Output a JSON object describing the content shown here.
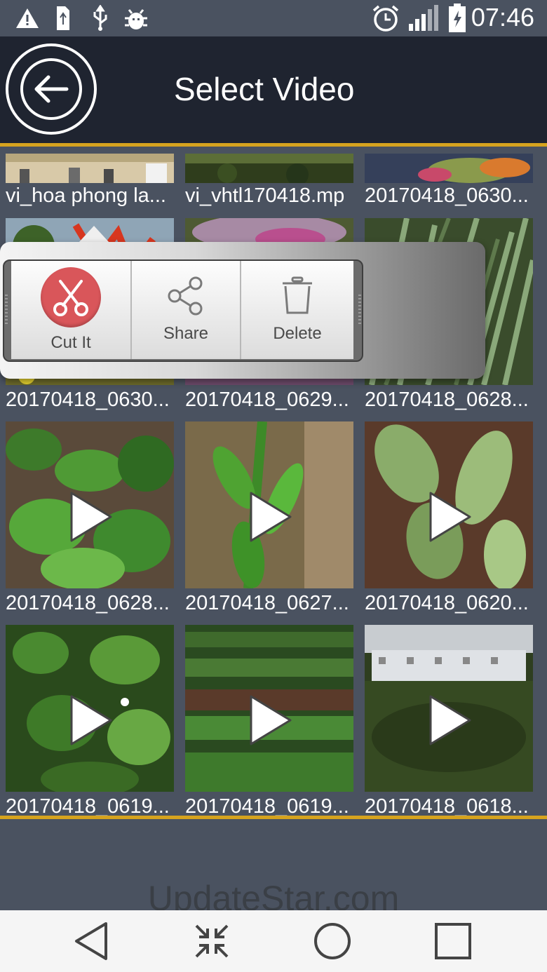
{
  "status_bar": {
    "time": "07:46",
    "left_icons": [
      "warning-icon",
      "usb-storage-icon",
      "usb-icon",
      "debug-bug-icon"
    ],
    "right_icons": [
      "alarm-icon",
      "signal-icon",
      "battery-charging-icon"
    ]
  },
  "header": {
    "title": "Select Video",
    "back_icon": "back-arrow-icon"
  },
  "videos": [
    {
      "name": "vi_hoa phong la..."
    },
    {
      "name": "vi_vhtl170418.mp"
    },
    {
      "name": "20170418_0630..."
    },
    {
      "name": "20170418_0630..."
    },
    {
      "name": "20170418_0629..."
    },
    {
      "name": "20170418_0628..."
    },
    {
      "name": "20170418_0628..."
    },
    {
      "name": "20170418_0627..."
    },
    {
      "name": "20170418_0620..."
    },
    {
      "name": "20170418_0619..."
    },
    {
      "name": "20170418_0619..."
    },
    {
      "name": "20170418_0618..."
    }
  ],
  "context_menu": {
    "items": [
      {
        "label": "Cut It",
        "icon": "scissors-icon"
      },
      {
        "label": "Share",
        "icon": "share-icon"
      },
      {
        "label": "Delete",
        "icon": "trash-icon"
      }
    ]
  },
  "nav_bar": {
    "icons": [
      "back-triangle-icon",
      "collapse-icon",
      "home-circle-icon",
      "recents-square-icon"
    ]
  },
  "watermark": "UpdateStar.com",
  "colors": {
    "accent": "#d6a31e",
    "header_bg": "#1f2430",
    "page_bg": "#4a5260",
    "cut_button": "#d9565a"
  }
}
